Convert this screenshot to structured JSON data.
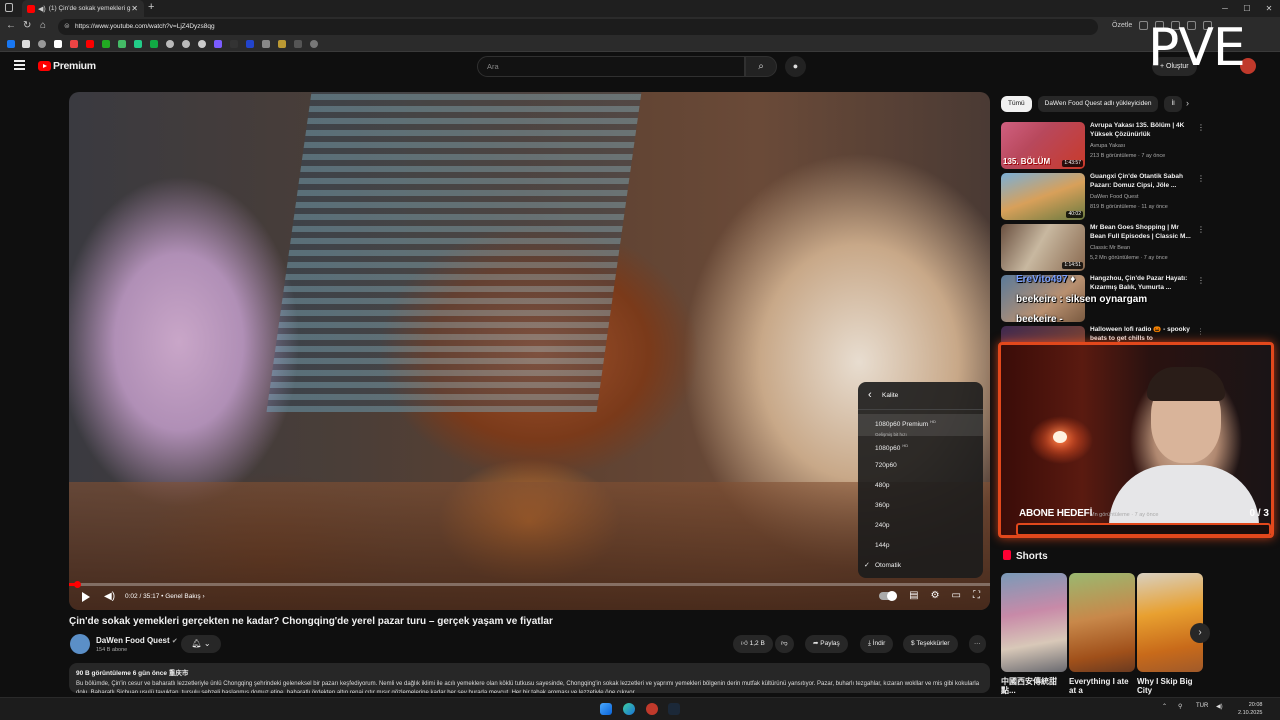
{
  "browser": {
    "tab_title": "(1) Çin'de sokak yemekleri g",
    "url": "https://www.youtube.com/watch?v=LjZ4Dyzs8qg",
    "summarize_label": "Özetle"
  },
  "header": {
    "logo_text": "Premium",
    "search_placeholder": "Ara",
    "create_label": "+ Oluştur"
  },
  "overlay": {
    "brand": "PVE"
  },
  "player": {
    "time": "0:02 / 35:17",
    "chapter": "• Genel Bakış ›",
    "progress_fraction": 0.001
  },
  "quality_menu": {
    "title": "Kalite",
    "items": [
      {
        "label": "1080p60 Premium",
        "badge": "HD",
        "sub": "Gelişmiş bit hızı",
        "highlighted": true
      },
      {
        "label": "1080p60",
        "badge": "HD"
      },
      {
        "label": "720p60"
      },
      {
        "label": "480p"
      },
      {
        "label": "360p"
      },
      {
        "label": "240p"
      },
      {
        "label": "144p"
      },
      {
        "label": "Otomatik",
        "checked": true
      }
    ]
  },
  "video": {
    "title": "Çin'de sokak yemekleri gerçekten ne kadar? Chongqing'de yerel pazar turu – gerçek yaşam ve fiyatlar",
    "channel": "DaWen Food Quest",
    "subscribers": "154 B abone",
    "likes": "1,2 B",
    "share_label": "Paylaş",
    "download_label": "İndir",
    "thanks_label": "Teşekkürler",
    "more_label": "···",
    "meta": "90 B görüntüleme  6 gün önce  重庆市",
    "description": "Bu bölümde, Çin'in cesur ve baharatlı lezzetleriyle ünlü Chongqing şehrindeki geleneksel bir pazarı keşfediyorum. Nemli ve dağlık iklimi ile acılı yemeklere olan köklü tutkusu sayesinde, Chongqing'in sokak lezzetleri ve yaprımı yemekleri bölgenin derin mutfak kültürünü yansıtıyor. Pazar, buharlı tezgahlar, kızaran wokllar ve mis gibi kokularla dolu. Baharatlı Sichuan usulü tavuktan, turşulu sebzeli haşlanmış domuz etine, baharatlı ördekten altın renai cıtır mısır gözlemelerine kadar her sev burada mevcut. Her bir tabak aroması ve lezzetiyle öne çıkıyor."
  },
  "sidebar": {
    "chips": [
      "Tümü",
      "DaWen Food Quest adlı yükleyiciden",
      "İl"
    ],
    "recs": [
      {
        "title": "Avrupa Yakası 135. Bölüm | 4K Yüksek Çözünürlük",
        "channel": "Avrupa Yakası",
        "views": "213 B görüntüleme · 7 ay önce",
        "duration": "1:43:57",
        "thumb_text": "135. BÖLÜM"
      },
      {
        "title": "Guangxi Çin'de Otantik Sabah Pazarı: Domuz Cipsi, Jöle ...",
        "channel": "DaWen Food Quest",
        "views": "819 B görüntüleme · 11 ay önce",
        "duration": "40:02"
      },
      {
        "title": "Mr Bean Goes Shopping | Mr Bean Full Episodes | Classic M...",
        "channel": "Classic Mr Bean",
        "views": "5,2 Mn görüntüleme · 7 ay önce",
        "duration": "1:14:51"
      },
      {
        "title": "Hangzhou, Çin'de Pazar Hayatı: Kızarmış Balık, Yumurta ...",
        "channel": "",
        "views": "",
        "duration": ""
      },
      {
        "title": "Halloween lofi radio 🎃 - spooky beats to get chills to",
        "channel": "",
        "views": "",
        "duration": ""
      }
    ],
    "hidden_meta": "Mn görüntüleme · 7 ay önce"
  },
  "stream_overlay": {
    "chat_lines": [
      {
        "user": "EreVito497",
        "text": " ♦"
      },
      {
        "user": "beekeire",
        "text": "siksen oynargam"
      },
      {
        "user": "beekeire",
        "text": "-"
      }
    ],
    "goal_label": "ABONE HEDEFİ",
    "goal_count": "0  / 3"
  },
  "shorts": {
    "heading": "Shorts",
    "items": [
      {
        "title": "中國西安傳統甜點..."
      },
      {
        "title": "Everything I ate at a"
      },
      {
        "title": "Why I Skip Big City"
      }
    ]
  },
  "taskbar": {
    "lang": "TUR",
    "time": "20:08",
    "date": "2.10.2025"
  },
  "colors": {
    "accent": "#ff0000",
    "background": "#0f0f0f",
    "stream_border": "#e2481c"
  }
}
